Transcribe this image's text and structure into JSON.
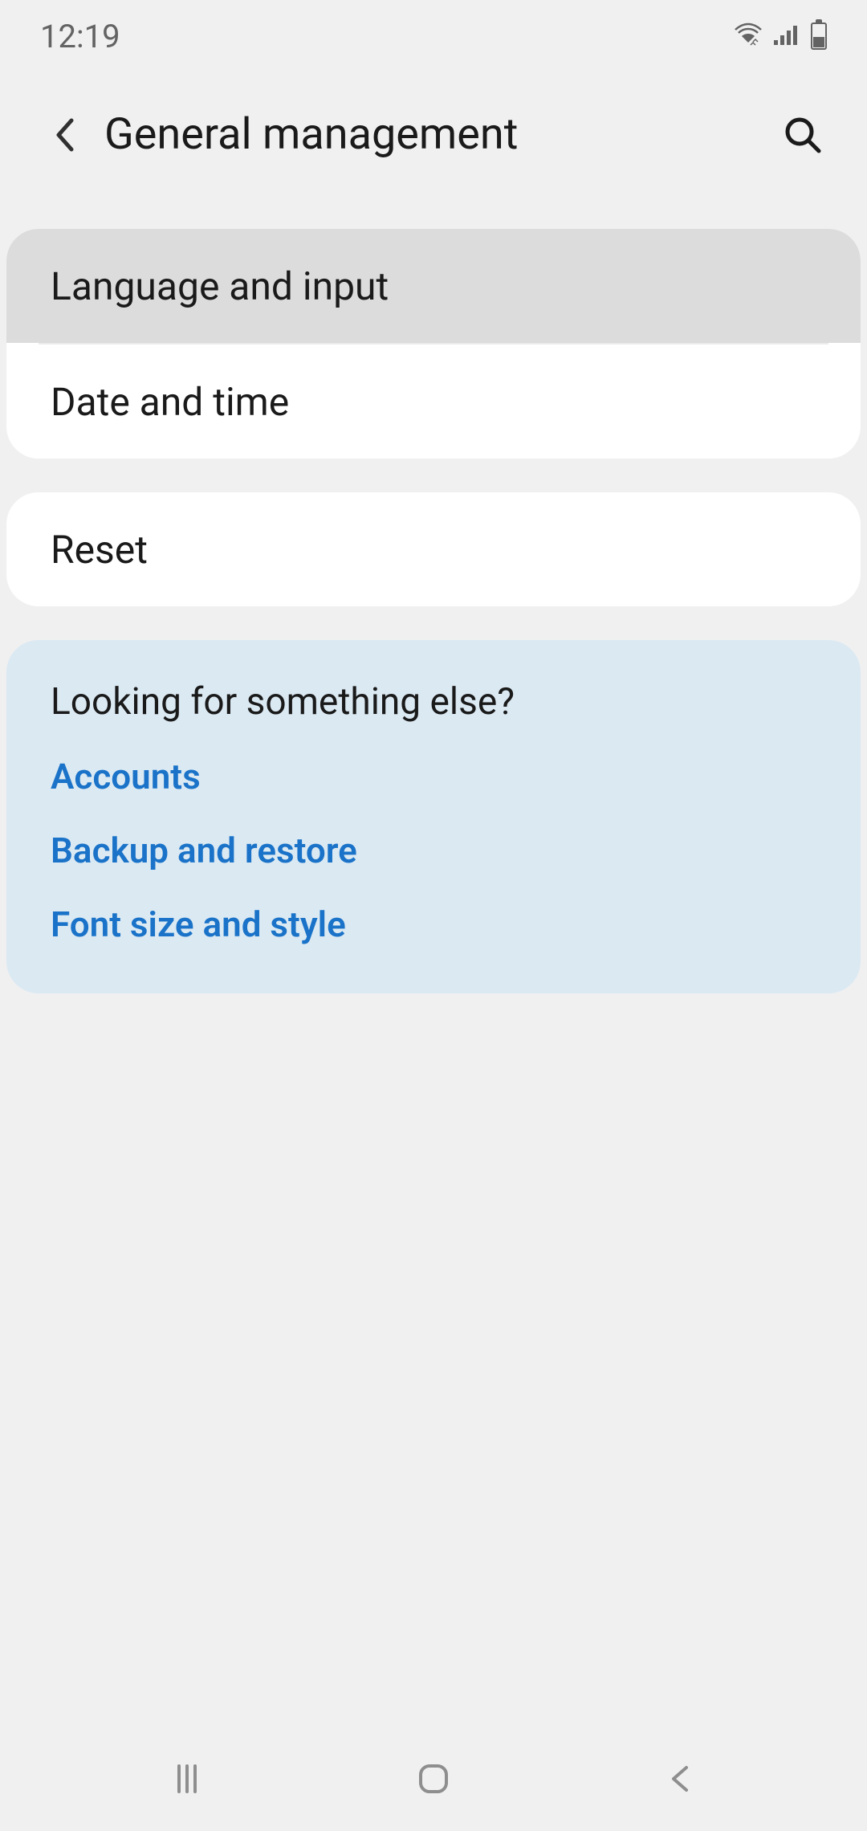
{
  "statusBar": {
    "time": "12:19"
  },
  "header": {
    "title": "General management"
  },
  "group1": {
    "items": [
      {
        "label": "Language and input",
        "selected": true
      },
      {
        "label": "Date and time",
        "selected": false
      }
    ]
  },
  "group2": {
    "items": [
      {
        "label": "Reset"
      }
    ]
  },
  "suggestions": {
    "title": "Looking for something else?",
    "links": [
      {
        "label": "Accounts"
      },
      {
        "label": "Backup and restore"
      },
      {
        "label": "Font size and style"
      }
    ]
  }
}
